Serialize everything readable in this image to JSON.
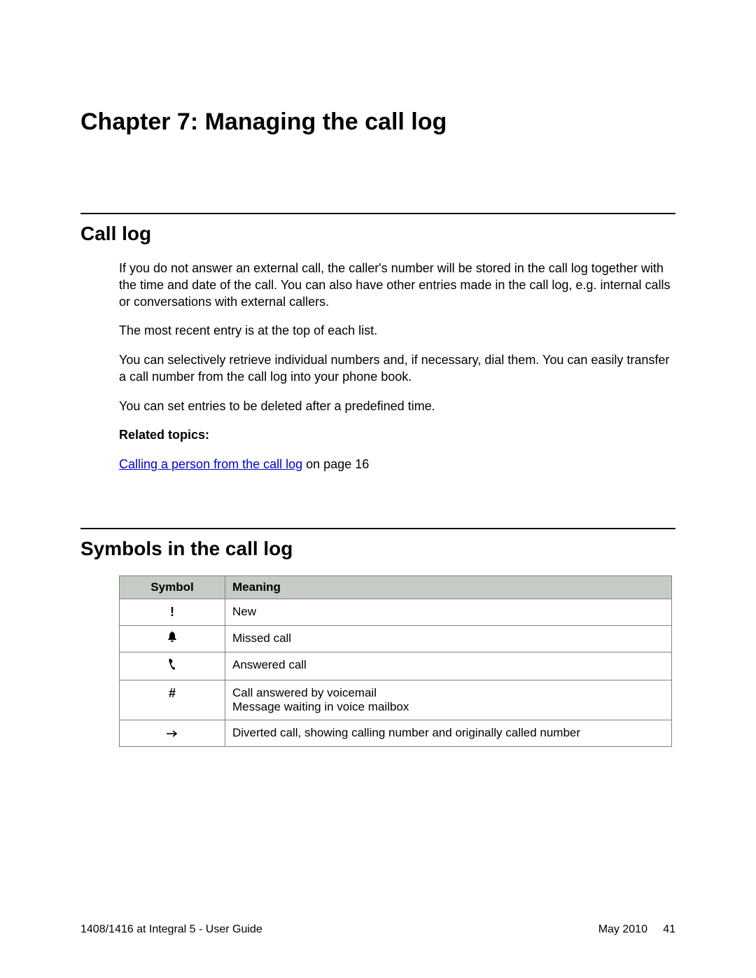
{
  "chapter": {
    "title": "Chapter 7:  Managing the call log"
  },
  "section_calllog": {
    "title": "Call log",
    "para1": "If you do not answer an external call, the caller's number will be stored in the call log together with the time and date of the call. You can also have other entries made in the call log, e.g. internal calls or conversations with external callers.",
    "para2": "The most recent entry is at the top of each list.",
    "para3": "You can selectively retrieve individual numbers and, if necessary, dial them. You can easily transfer a call number from the call log into your phone book.",
    "para4": "You can set entries to be deleted after a predefined time.",
    "related_label": "Related topics:",
    "related_link": "Calling a person from the call log",
    "related_tail": " on page 16"
  },
  "section_symbols": {
    "title": "Symbols in the call log",
    "col_symbol": "Symbol",
    "col_meaning": "Meaning",
    "rows": [
      {
        "symbol": "!",
        "icon_name": "exclamation-icon",
        "meaning": "New"
      },
      {
        "symbol": "🔔",
        "icon_name": "bell-icon",
        "meaning": "Missed call"
      },
      {
        "symbol": "📞",
        "icon_name": "handset-icon",
        "meaning": "Answered call"
      },
      {
        "symbol": "#",
        "icon_name": "hash-icon",
        "meaning": "Call answered by voicemail\nMessage waiting in voice mailbox"
      },
      {
        "symbol": "→",
        "icon_name": "arrow-right-icon",
        "meaning": "Diverted call, showing calling number and originally called number"
      }
    ]
  },
  "footer": {
    "left": "1408/1416 at Integral 5 - User Guide",
    "right": "May 2010     41"
  }
}
